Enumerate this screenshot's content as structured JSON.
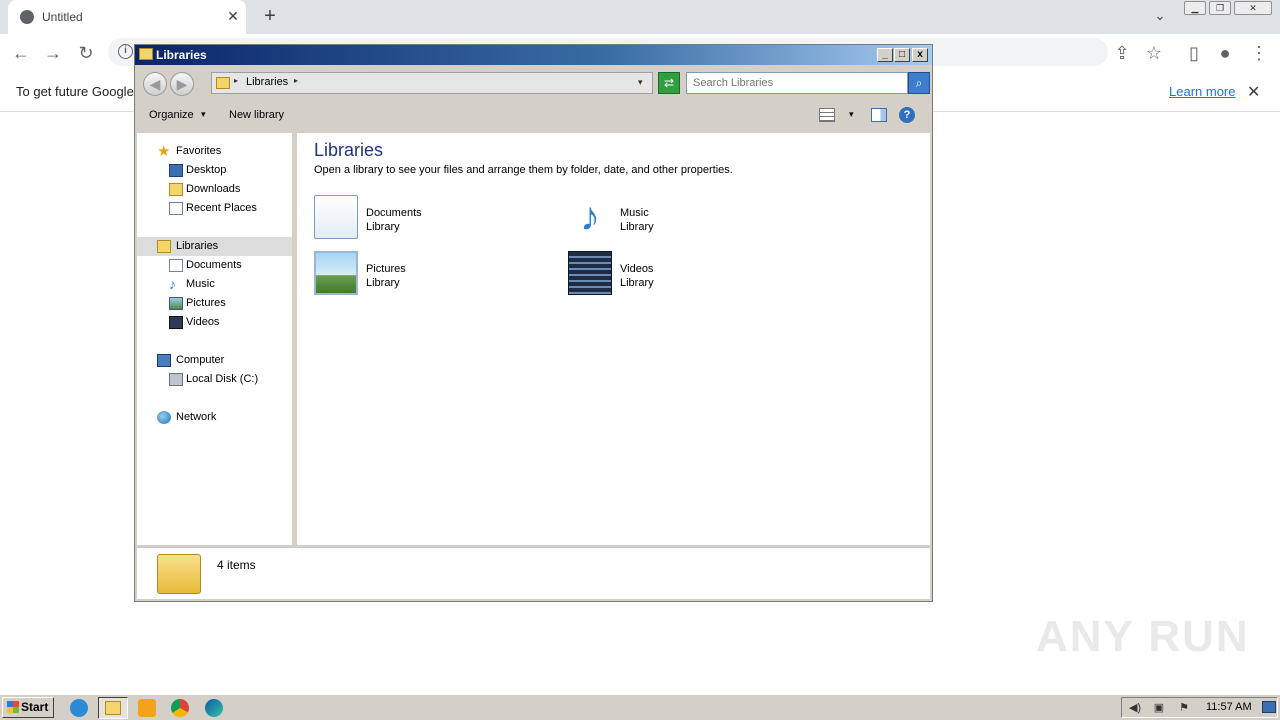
{
  "browser": {
    "tab_title": "Untitled",
    "tab_close": "✕",
    "new_tab": "+",
    "tab_search": "⌄",
    "infobar_text": "To get future Google",
    "learn_more": "Learn more",
    "infobar_close": "✕",
    "info_icon": "i",
    "back": "←",
    "forward": "→",
    "reload": "↻",
    "share": "⇪",
    "star": "☆",
    "sidepanel": "▯",
    "profile": "●",
    "menu": "⋮"
  },
  "explorer": {
    "title": "Libraries",
    "caption": {
      "min": "_",
      "max": "□",
      "close": "x"
    },
    "address": {
      "location": "Libraries",
      "sep": "▸",
      "dropdown": "▾"
    },
    "search_placeholder": "Search Libraries",
    "toolbar": {
      "organize": "Organize",
      "new_library": "New library",
      "dropdown": "▾",
      "help": "?"
    },
    "nav": {
      "favorites": "Favorites",
      "desktop": "Desktop",
      "downloads": "Downloads",
      "recent_places": "Recent Places",
      "libraries": "Libraries",
      "documents": "Documents",
      "music": "Music",
      "pictures": "Pictures",
      "videos": "Videos",
      "computer": "Computer",
      "local_disk": "Local Disk (C:)",
      "network": "Network"
    },
    "content": {
      "title": "Libraries",
      "description": "Open a library to see your files and arrange them by folder, date, and other properties.",
      "libraries": [
        {
          "name": "Documents",
          "type": "Library",
          "icon": "documents-library-icon"
        },
        {
          "name": "Music",
          "type": "Library",
          "icon": "music-library-icon"
        },
        {
          "name": "Pictures",
          "type": "Library",
          "icon": "pictures-library-icon"
        },
        {
          "name": "Videos",
          "type": "Library",
          "icon": "videos-library-icon"
        }
      ]
    },
    "status": "4 items"
  },
  "watermark": "ANY RUN",
  "taskbar": {
    "start": "Start",
    "clock": "11:57 AM"
  }
}
